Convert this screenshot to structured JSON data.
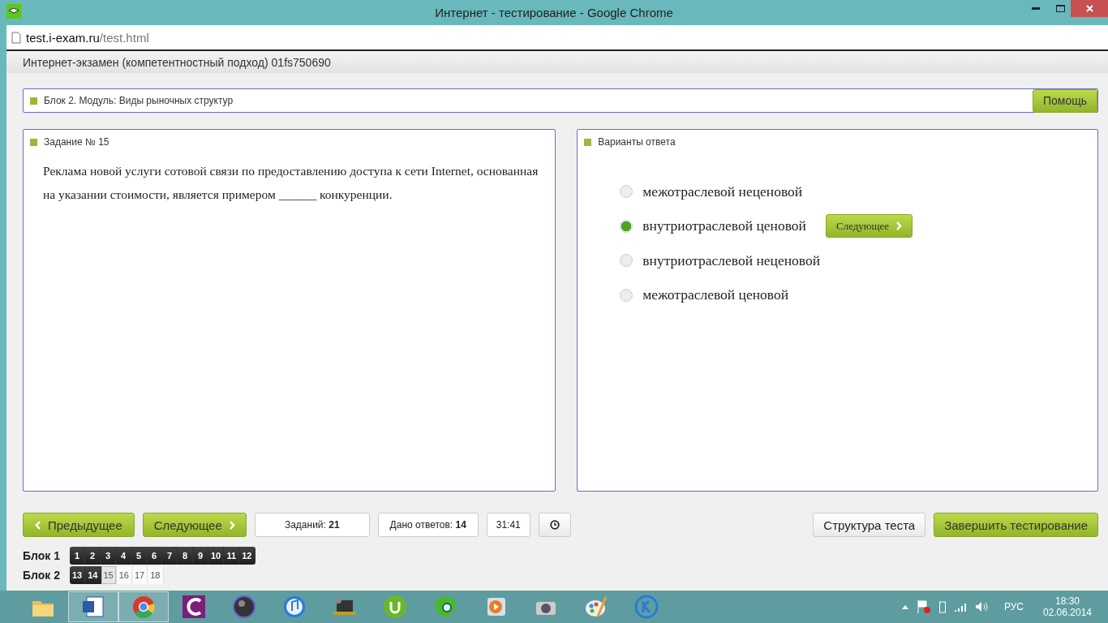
{
  "window": {
    "title": "Интернет - тестирование - Google Chrome"
  },
  "address": {
    "host": "test.i-exam.ru",
    "path": "/test.html"
  },
  "header": {
    "title": "Интернет-экзамен (компетентностный подход) 01fs750690"
  },
  "module": {
    "title": "Блок 2. Модуль: Виды рыночных структур",
    "help": "Помощь"
  },
  "task": {
    "title": "Задание № 15",
    "text": "Реклама новой услуги сотовой связи по предоставлению доступа к сети Internet, основанная на указании стоимости, является примером ______ конкуренции."
  },
  "answers": {
    "title": "Варианты ответа",
    "next": "Следующее",
    "options": [
      {
        "label": "межотраслевой неценовой",
        "selected": false
      },
      {
        "label": "внутриотраслевой ценовой",
        "selected": true
      },
      {
        "label": "внутриотраслевой неценовой",
        "selected": false
      },
      {
        "label": "межотраслевой ценовой",
        "selected": false
      }
    ]
  },
  "nav": {
    "prev": "Предыдущее",
    "next": "Следующее",
    "tasks_label": "Заданий:",
    "tasks_count": "21",
    "answered_label": "Дано ответов:",
    "answered_count": "14",
    "timer": "31:41",
    "structure": "Структура теста",
    "finish": "Завершить тестирование"
  },
  "blocks": [
    {
      "label": "Блок 1",
      "items": [
        {
          "n": "1",
          "answered": true,
          "selected": false
        },
        {
          "n": "2",
          "answered": true,
          "selected": false
        },
        {
          "n": "3",
          "answered": true,
          "selected": false
        },
        {
          "n": "4",
          "answered": true,
          "selected": false
        },
        {
          "n": "5",
          "answered": true,
          "selected": false
        },
        {
          "n": "6",
          "answered": true,
          "selected": false
        },
        {
          "n": "7",
          "answered": true,
          "selected": false
        },
        {
          "n": "8",
          "answered": true,
          "selected": false
        },
        {
          "n": "9",
          "answered": true,
          "selected": false
        },
        {
          "n": "10",
          "answered": true,
          "selected": false
        },
        {
          "n": "11",
          "answered": true,
          "selected": false
        },
        {
          "n": "12",
          "answered": true,
          "selected": false
        }
      ]
    },
    {
      "label": "Блок 2",
      "items": [
        {
          "n": "13",
          "answered": true,
          "selected": false
        },
        {
          "n": "14",
          "answered": true,
          "selected": false
        },
        {
          "n": "15",
          "answered": false,
          "selected": true
        },
        {
          "n": "16",
          "answered": false,
          "selected": false
        },
        {
          "n": "17",
          "answered": false,
          "selected": false
        },
        {
          "n": "18",
          "answered": false,
          "selected": false
        }
      ]
    }
  ],
  "taskbar": {
    "apps": [
      {
        "kind": "folder",
        "active": false
      },
      {
        "kind": "word",
        "active": true
      },
      {
        "kind": "chrome",
        "active": true
      },
      {
        "kind": "c",
        "active": false
      },
      {
        "kind": "dial",
        "active": false
      },
      {
        "kind": "music",
        "active": false
      },
      {
        "kind": "laptop",
        "active": false
      },
      {
        "kind": "torrent",
        "active": false
      },
      {
        "kind": "shield",
        "active": false
      },
      {
        "kind": "player",
        "active": false
      },
      {
        "kind": "camera",
        "active": false
      },
      {
        "kind": "paint",
        "active": false
      },
      {
        "kind": "k",
        "active": false
      }
    ],
    "lang": "РУС",
    "time": "18:30",
    "date": "02.06.2014"
  }
}
